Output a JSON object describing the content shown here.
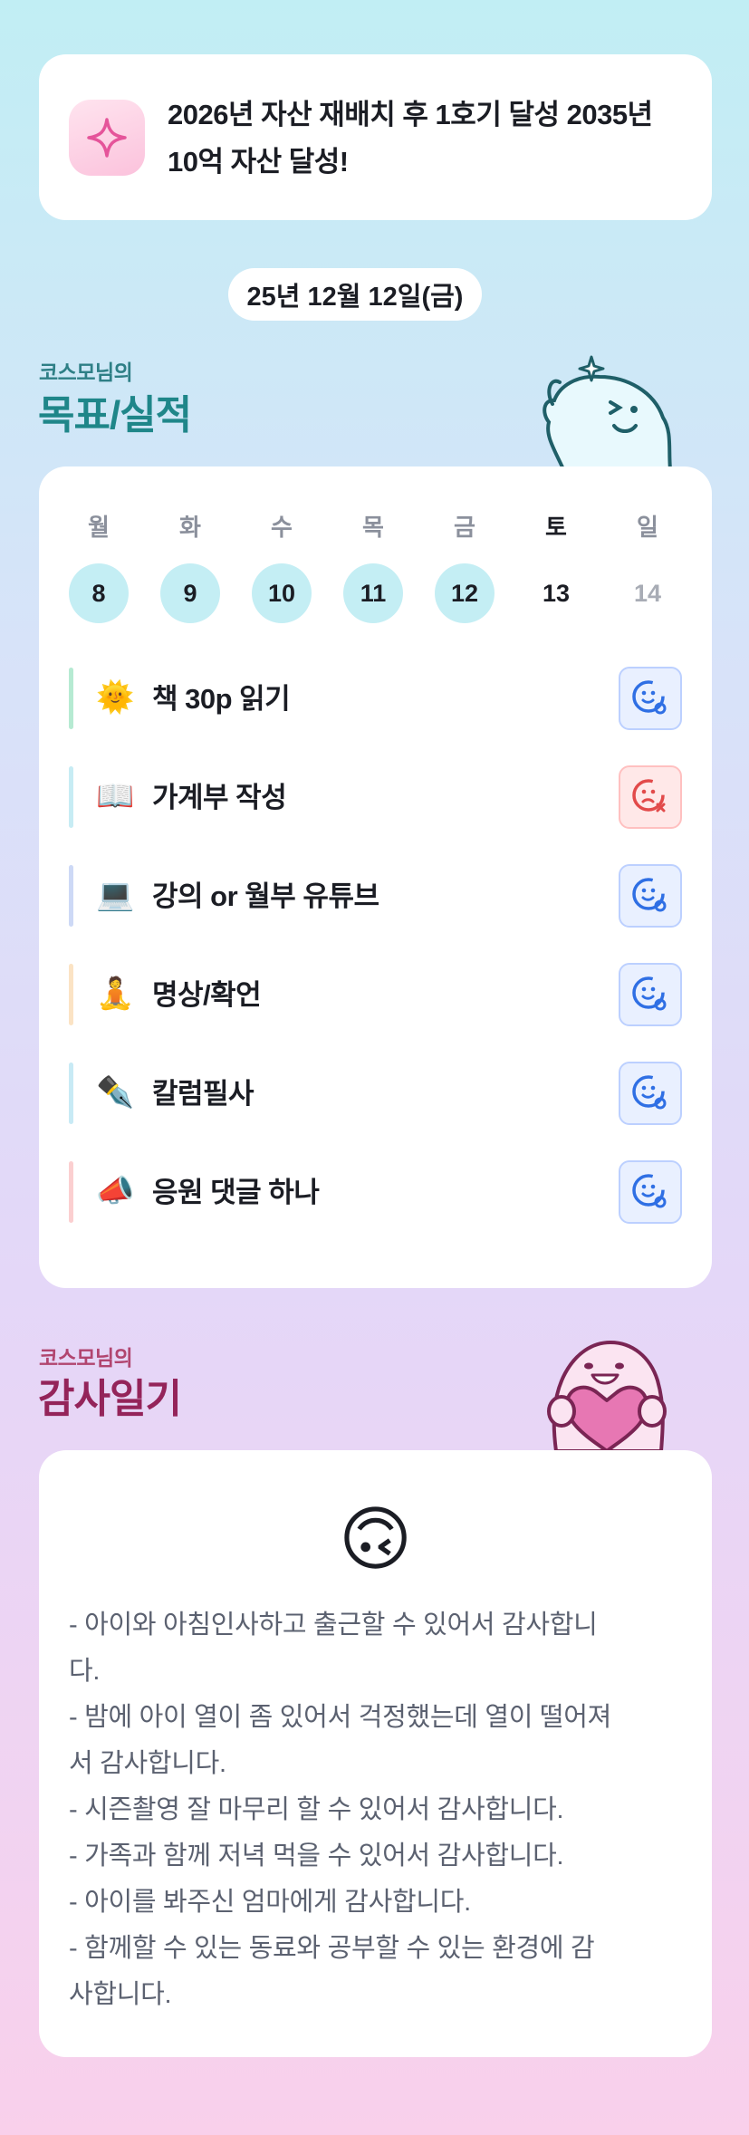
{
  "goal_banner": {
    "icon": "sparkle-icon",
    "text": "2026년 자산 재배치 후 1호기 달성 2035년 10억 자산 달성!"
  },
  "date": "25년 12월 12일(금)",
  "goals_section": {
    "owner": "코스모님의",
    "title": "목표/실적"
  },
  "week": {
    "days": [
      "월",
      "화",
      "수",
      "목",
      "금",
      "토",
      "일"
    ],
    "dates": [
      "8",
      "9",
      "10",
      "11",
      "12",
      "13",
      "14"
    ]
  },
  "tasks": [
    {
      "emoji": "🌞",
      "label": "책 30p 읽기",
      "status": "done",
      "bar_color": "#b6ead2"
    },
    {
      "emoji": "📖",
      "label": "가계부 작성",
      "status": "failed",
      "bar_color": "#c7ecf4"
    },
    {
      "emoji": "💻",
      "label": "강의 or 월부 유튜브",
      "status": "done",
      "bar_color": "#cdd9f6"
    },
    {
      "emoji": "🧘",
      "label": "명상/확언",
      "status": "done",
      "bar_color": "#fbe3c4"
    },
    {
      "emoji": "✒️",
      "label": "칼럼필사",
      "status": "done",
      "bar_color": "#c8eaf5"
    },
    {
      "emoji": "📣",
      "label": "응원 댓글 하나",
      "status": "done",
      "bar_color": "#fbcfd0"
    }
  ],
  "gratitude_section": {
    "owner": "코스모님의",
    "title": "감사일기",
    "mood_emoji": "🙃",
    "lines": [
      "- 아이와 아침인사하고 출근할 수 있어서 감사합니",
      "다.",
      "- 밤에 아이 열이 좀 있어서 걱정했는데 열이 떨어져",
      "서 감사합니다.",
      "- 시즌촬영 잘 마무리 할 수 있어서 감사합니다.",
      "- 가족과 함께 저녁 먹을 수 있어서 감사합니다.",
      "- 아이를 봐주신 엄마에게 감사합니다.",
      "- 함께할 수 있는 동료와 공부할 수 있는 환경에 감",
      "사합니다."
    ]
  },
  "colors": {
    "accent_teal": "#1f8689",
    "accent_magenta": "#94245a",
    "done_day_bg": "#c4eef4",
    "status_ok": "#2f6fe4",
    "status_fail": "#e24a4a"
  }
}
